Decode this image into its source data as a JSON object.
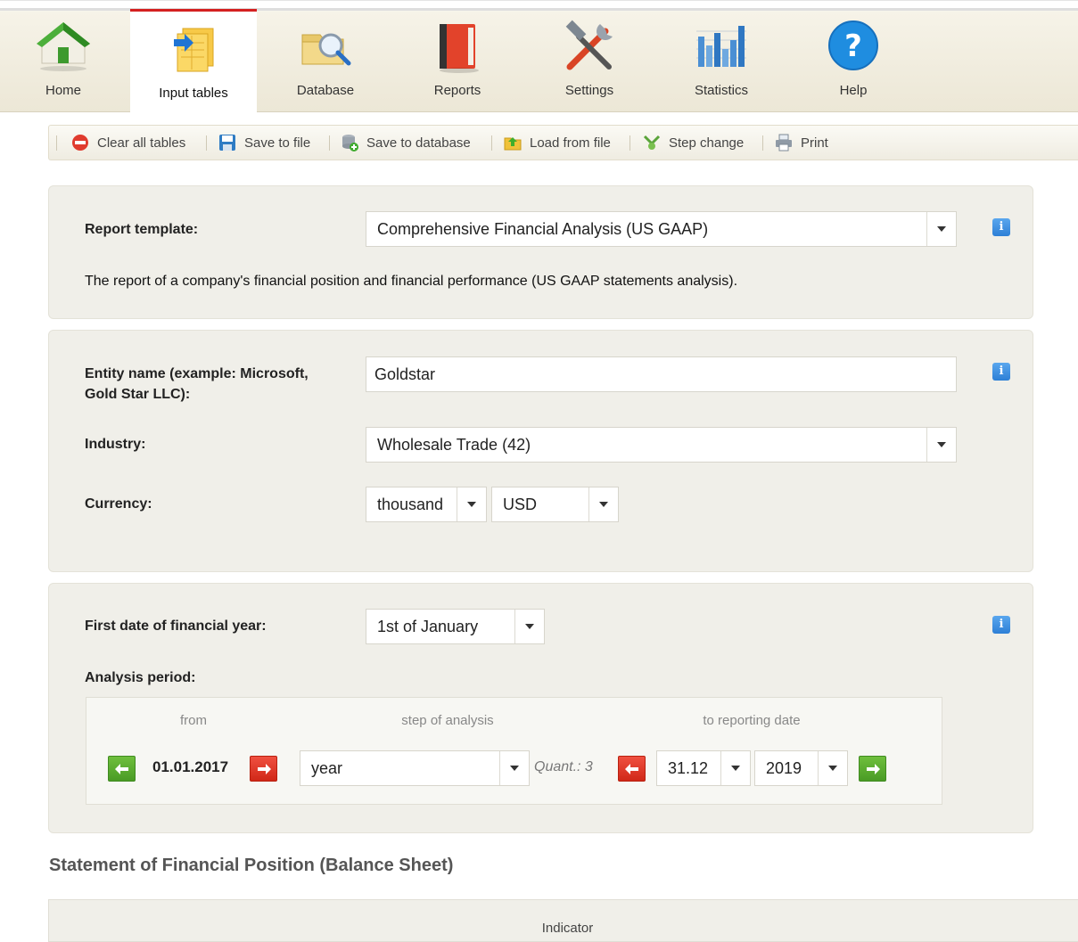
{
  "nav": {
    "tabs": [
      {
        "label": "Home",
        "icon": "home-icon"
      },
      {
        "label": "Input tables",
        "icon": "input-tables-icon",
        "active": true
      },
      {
        "label": "Database",
        "icon": "database-icon"
      },
      {
        "label": "Reports",
        "icon": "reports-icon"
      },
      {
        "label": "Settings",
        "icon": "settings-icon"
      },
      {
        "label": "Statistics",
        "icon": "statistics-icon"
      },
      {
        "label": "Help",
        "icon": "help-icon"
      }
    ],
    "active_color": "#d42020"
  },
  "toolbar": {
    "clear": "Clear all tables",
    "save_file": "Save to file",
    "save_db": "Save to database",
    "load_file": "Load from file",
    "step_change": "Step change",
    "print": "Print"
  },
  "template_panel": {
    "label": "Report template:",
    "value": "Comprehensive Financial Analysis (US GAAP)",
    "description": "The report of a company's financial position and financial performance (US GAAP statements analysis)."
  },
  "entity_panel": {
    "entity_label_line1": "Entity name (example: Microsoft,",
    "entity_label_line2": "Gold Star LLC):",
    "entity_value": "Goldstar",
    "industry_label": "Industry:",
    "industry_value": "Wholesale Trade (42)",
    "currency_label": "Currency:",
    "currency_unit": "thousand",
    "currency_code": "USD"
  },
  "period_panel": {
    "first_date_label": "First date of financial year:",
    "first_date_value": "1st of January",
    "analysis_label": "Analysis period:",
    "col_from": "from",
    "col_step": "step of analysis",
    "col_to": "to reporting date",
    "from_date": "01.01.2017",
    "step_value": "year",
    "quant": "Quant.: 3",
    "to_day": "31.12",
    "to_year": "2019"
  },
  "info_icon_text": "i",
  "balance": {
    "title": "Statement of Financial Position (Balance Sheet)",
    "col_indicator": "Indicator"
  }
}
